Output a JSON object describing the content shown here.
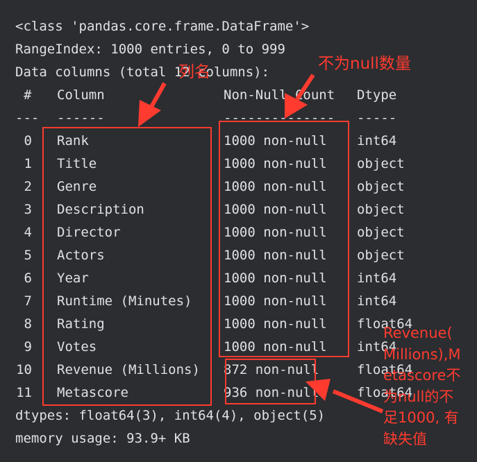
{
  "console": {
    "class_line": "<class 'pandas.core.frame.DataFrame'>",
    "range_index": "RangeIndex: 1000 entries, 0 to 999",
    "data_columns": "Data columns (total 12 columns):",
    "header": {
      "num": "#",
      "column": "Column",
      "nonnull": "Non-Null Count",
      "dtype": "Dtype"
    },
    "separator": {
      "num": "---",
      "column": "------",
      "nonnull": "--------------",
      "dtype": "-----"
    },
    "rows": [
      {
        "num": "0",
        "column": "Rank",
        "nonnull": "1000 non-null",
        "dtype": "int64"
      },
      {
        "num": "1",
        "column": "Title",
        "nonnull": "1000 non-null",
        "dtype": "object"
      },
      {
        "num": "2",
        "column": "Genre",
        "nonnull": "1000 non-null",
        "dtype": "object"
      },
      {
        "num": "3",
        "column": "Description",
        "nonnull": "1000 non-null",
        "dtype": "object"
      },
      {
        "num": "4",
        "column": "Director",
        "nonnull": "1000 non-null",
        "dtype": "object"
      },
      {
        "num": "5",
        "column": "Actors",
        "nonnull": "1000 non-null",
        "dtype": "object"
      },
      {
        "num": "6",
        "column": "Year",
        "nonnull": "1000 non-null",
        "dtype": "int64"
      },
      {
        "num": "7",
        "column": "Runtime (Minutes)",
        "nonnull": "1000 non-null",
        "dtype": "int64"
      },
      {
        "num": "8",
        "column": "Rating",
        "nonnull": "1000 non-null",
        "dtype": "float64"
      },
      {
        "num": "9",
        "column": "Votes",
        "nonnull": "1000 non-null",
        "dtype": "int64"
      },
      {
        "num": "10",
        "column": "Revenue (Millions)",
        "nonnull": "872 non-null",
        "dtype": "float64"
      },
      {
        "num": "11",
        "column": "Metascore",
        "nonnull": "936 non-null",
        "dtype": "float64"
      }
    ],
    "dtypes": "dtypes: float64(3), int64(4), object(5)",
    "memory": "memory usage: 93.9+ KB"
  },
  "annotations": {
    "column_names": "列名",
    "nonnull_count": "不为null数量",
    "missing_note": [
      "Revenue(",
      "Millions),M",
      "etascore不",
      "为null的不",
      "足1000, 有",
      "缺失值"
    ]
  },
  "colors": {
    "background": "#2b2d30",
    "text": "#dfe1e5",
    "annotation": "#ff3b30"
  }
}
